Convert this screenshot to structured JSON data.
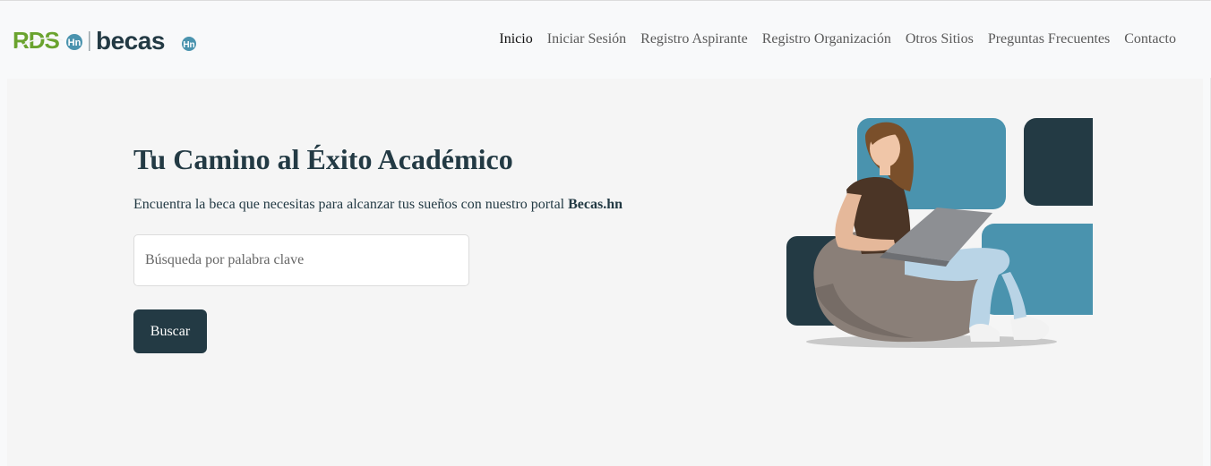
{
  "brand": {
    "logo_rds": "RDS",
    "logo_rds_badge": "Hn",
    "logo_becas": "becas",
    "logo_becas_badge": "Hn"
  },
  "nav": [
    {
      "label": "Inicio",
      "active": true
    },
    {
      "label": "Iniciar Sesión"
    },
    {
      "label": "Registro Aspirante"
    },
    {
      "label": "Registro Organización"
    },
    {
      "label": "Otros Sitios"
    },
    {
      "label": "Preguntas Frecuentes"
    },
    {
      "label": "Contacto"
    }
  ],
  "hero": {
    "title": "Tu Camino al Éxito Académico",
    "subtitle_prefix": "Encuentra la beca que necesitas para alcanzar tus sueños con nuestro portal ",
    "subtitle_strong": "Becas.hn",
    "search_placeholder": "Búsqueda por palabra clave",
    "search_value": "",
    "search_button": "Buscar"
  },
  "colors": {
    "primary_dark": "#233a44",
    "accent_blue": "#4a93ae",
    "rds_green": "#6aa32e",
    "hero_bg": "#f5f5f5"
  },
  "icons": {
    "hero_image": "student-with-laptop-illustration"
  }
}
